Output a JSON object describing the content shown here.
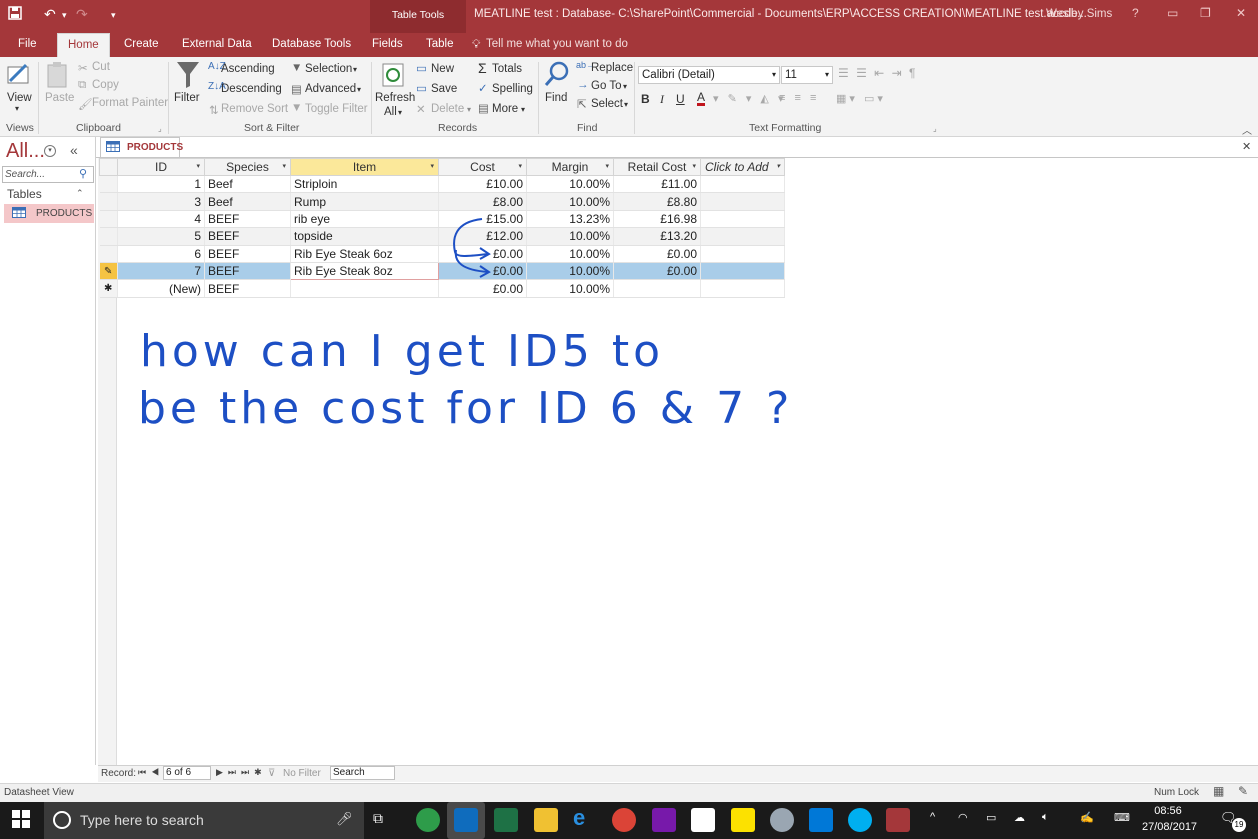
{
  "titlebar": {
    "context_tab": "Table Tools",
    "window_title": "MEATLINE test : Database- C:\\SharePoint\\Commercial - Documents\\ERP\\ACCESS CREATION\\MEATLINE test.accdb...",
    "user": "Wesley Sims",
    "help": "?"
  },
  "menu": {
    "tabs": [
      "File",
      "Home",
      "Create",
      "External Data",
      "Database Tools",
      "Fields",
      "Table"
    ],
    "tell_me": "Tell me what you want to do"
  },
  "ribbon": {
    "views": {
      "view": "View",
      "group": "Views"
    },
    "clipboard": {
      "paste": "Paste",
      "cut": "Cut",
      "copy": "Copy",
      "format_painter": "Format Painter",
      "group": "Clipboard"
    },
    "sort_filter": {
      "filter": "Filter",
      "ascending": "Ascending",
      "descending": "Descending",
      "remove_sort": "Remove Sort",
      "selection": "Selection",
      "advanced": "Advanced",
      "toggle_filter": "Toggle Filter",
      "group": "Sort & Filter"
    },
    "records": {
      "refresh": "Refresh",
      "refresh_all": "All",
      "new": "New",
      "save": "Save",
      "delete": "Delete",
      "totals": "Totals",
      "spelling": "Spelling",
      "more": "More",
      "group": "Records"
    },
    "find": {
      "find": "Find",
      "replace": "Replace",
      "goto": "Go To",
      "select": "Select",
      "group": "Find"
    },
    "text_formatting": {
      "font": "Calibri (Detail)",
      "size": "11",
      "bold": "B",
      "italic": "I",
      "underline": "U",
      "font_color": "A",
      "group": "Text Formatting"
    }
  },
  "nav": {
    "header": "All...",
    "search_placeholder": "Search...",
    "section": "Tables",
    "items": [
      "PRODUCTS"
    ]
  },
  "document_tab": "PRODUCTS",
  "table": {
    "columns": [
      "ID",
      "Species",
      "Item",
      "Cost",
      "Margin",
      "Retail Cost",
      "Click to Add"
    ],
    "rows": [
      [
        "1",
        "Beef",
        "Striploin",
        "£10.00",
        "10.00%",
        "£11.00"
      ],
      [
        "3",
        "Beef",
        "Rump",
        "£8.00",
        "10.00%",
        "£8.80"
      ],
      [
        "4",
        "BEEF",
        "rib eye",
        "£15.00",
        "13.23%",
        "£16.98"
      ],
      [
        "5",
        "BEEF",
        "topside",
        "£12.00",
        "10.00%",
        "£13.20"
      ],
      [
        "6",
        "BEEF",
        "Rib Eye Steak 6oz",
        "£0.00",
        "10.00%",
        "£0.00"
      ],
      [
        "7",
        "BEEF",
        "Rib Eye Steak 8oz",
        "£0.00",
        "10.00%",
        "£0.00"
      ]
    ],
    "new_row": [
      "(New)",
      "BEEF",
      "",
      "£0.00",
      "10.00%",
      ""
    ]
  },
  "record_nav": {
    "label": "Record:",
    "position": "6 of 6",
    "filter": "No Filter",
    "search": "Search"
  },
  "annotation": {
    "line1": "how can I get ID5 to",
    "line2": "be the cost for ID 6 & 7 ?"
  },
  "status": {
    "view": "Datasheet View",
    "numlock": "Num Lock"
  },
  "taskbar": {
    "search": "Type here to search",
    "time": "08:56",
    "date": "27/08/2017",
    "notifications": "19"
  }
}
